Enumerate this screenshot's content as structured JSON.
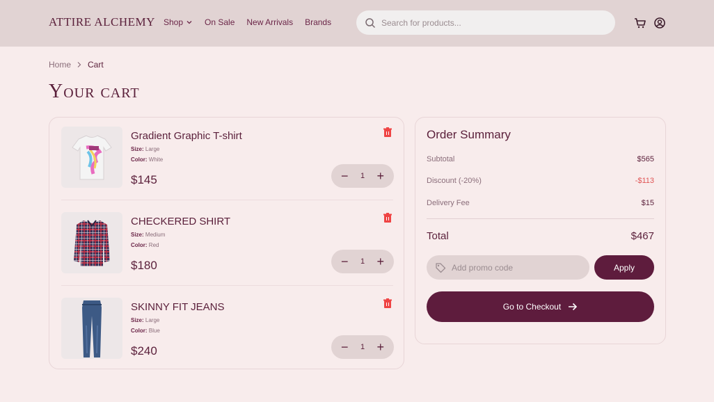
{
  "header": {
    "logo": "ATTIRE ALCHEMY",
    "nav": [
      "Shop",
      "On Sale",
      "New Arrivals",
      "Brands"
    ],
    "search_placeholder": "Search for products..."
  },
  "breadcrumb": {
    "home": "Home",
    "current": "Cart"
  },
  "page_title": "Your cart",
  "cart_items": [
    {
      "name": "Gradient Graphic T-shirt",
      "size_label": "Size:",
      "size": "Large",
      "color_label": "Color:",
      "color": "White",
      "price": "$145",
      "qty": "1"
    },
    {
      "name": "CHECKERED SHIRT",
      "size_label": "Size:",
      "size": "Medium",
      "color_label": "Color:",
      "color": "Red",
      "price": "$180",
      "qty": "1"
    },
    {
      "name": "SKINNY FIT JEANS",
      "size_label": "Size:",
      "size": "Large",
      "color_label": "Color:",
      "color": "Blue",
      "price": "$240",
      "qty": "1"
    }
  ],
  "summary": {
    "title": "Order Summary",
    "subtotal_label": "Subtotal",
    "subtotal": "$565",
    "discount_label": "Discount (-20%)",
    "discount": "-$113",
    "delivery_label": "Delivery Fee",
    "delivery": "$15",
    "total_label": "Total",
    "total": "$467",
    "promo_placeholder": "Add promo code",
    "apply_label": "Apply",
    "checkout_label": "Go to Checkout"
  },
  "colors": {
    "brand": "#5e1c3d",
    "background": "#f8ecec",
    "header": "#e1d3d3",
    "danger": "#e05555"
  }
}
